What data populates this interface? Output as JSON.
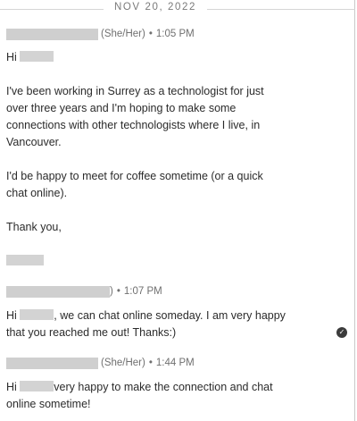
{
  "thread": {
    "date_divider": "NOV 20, 2022",
    "messages": [
      {
        "header": {
          "pronouns": "(She/Her)",
          "separator": "•",
          "time": "1:05 PM"
        },
        "greeting": "Hi",
        "paragraph1": [
          "I've been working in Surrey as a technologist for just",
          "over three years and I'm hoping to make some",
          "connections with other technologists where I live, in",
          "Vancouver."
        ],
        "paragraph2": [
          "I'd be happy to meet for coffee sometime (or a quick",
          "chat online)."
        ],
        "signoff": "Thank you,"
      },
      {
        "header": {
          "name_suffix": ")",
          "separator": "•",
          "time": "1:07 PM"
        },
        "line1_start": "Hi",
        "line1_rest": ", we can chat online someday. I am very happy",
        "line2": "that you reached me out! Thanks:)",
        "seen_icon": "check-circle-icon"
      },
      {
        "header": {
          "pronouns": "(She/Her)",
          "separator": "•",
          "time": "1:44 PM"
        },
        "line1_start": "Hi",
        "line1_rest": "very happy to make the connection and chat",
        "line2": "online sometime!"
      }
    ]
  },
  "colors": {
    "text": "#2b2b2b",
    "meta": "#707070",
    "redaction": "#cfcfcf",
    "divider": "#d5d5d5"
  }
}
